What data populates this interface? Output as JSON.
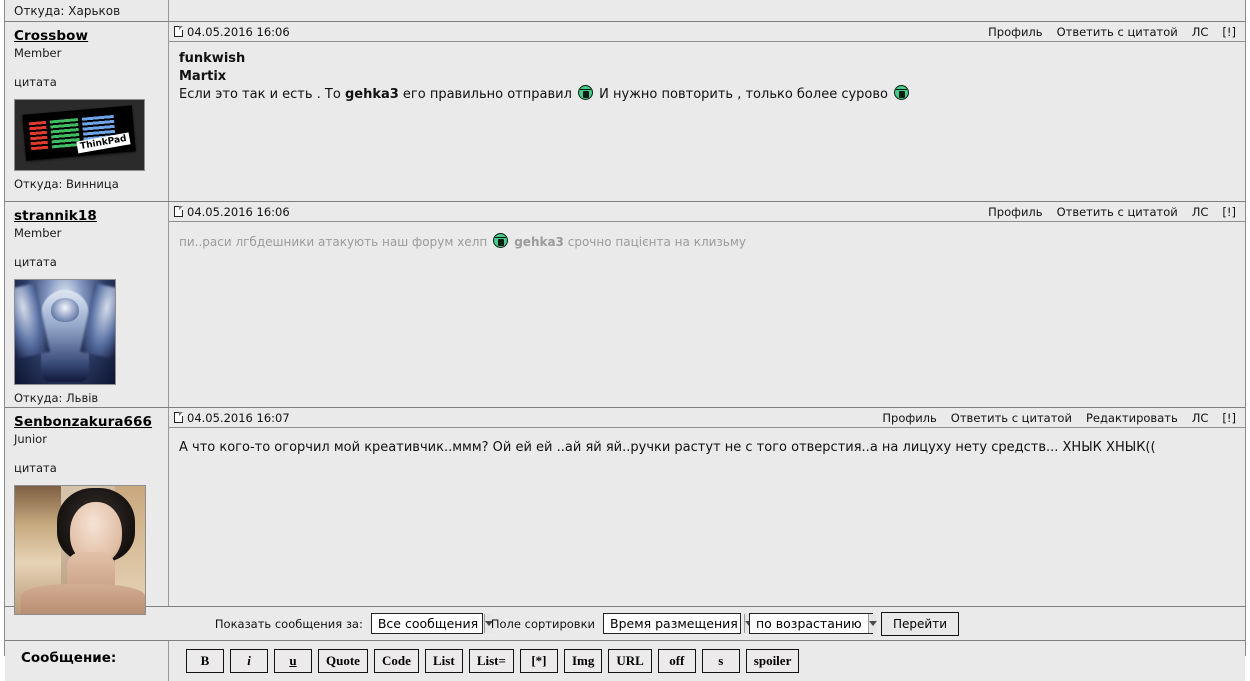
{
  "top_partial_row": {
    "location_label": "Откуда: Харьков"
  },
  "post_links": {
    "profile": "Профиль",
    "quote_reply": "Ответить с цитатой",
    "edit": "Редактировать",
    "pm": "ЛС",
    "report": "[!]"
  },
  "side_labels": {
    "quote": "цитата",
    "location_prefix": "Откуда:"
  },
  "posts": [
    {
      "username": "Crossbow",
      "rank": "Member",
      "quote_link": "цитата",
      "location": "Откуда: Винница",
      "avatar": "ibm-thinkpad-logo",
      "date": "04.05.2016 16:06",
      "links": [
        "Профиль",
        "Ответить с цитатой",
        "ЛС",
        "[!]"
      ],
      "quoted_names": [
        "funkwish",
        "Martix"
      ],
      "text_parts": [
        {
          "type": "text",
          "value": "Если это так и есть . То "
        },
        {
          "type": "bold",
          "value": "gehka3"
        },
        {
          "type": "text",
          "value": " его правильно отправил "
        },
        {
          "type": "smiley",
          "value": "green-smiley"
        },
        {
          "type": "text",
          "value": " И нужно повторить , только более сурово "
        },
        {
          "type": "smiley",
          "value": "green-smiley"
        }
      ]
    },
    {
      "username": "strannik18",
      "rank": "Member",
      "quote_link": "цитата",
      "location": "Откуда: Львів",
      "avatar": "warrior-angel-artwork",
      "date": "04.05.2016 16:06",
      "links": [
        "Профиль",
        "Ответить с цитатой",
        "ЛС",
        "[!]"
      ],
      "quoted_names": [],
      "text_parts": [
        {
          "type": "dim",
          "value": "пи..раси лгбдешники атакують наш форум хелп "
        },
        {
          "type": "smiley",
          "value": "green-smiley"
        },
        {
          "type": "dim-bold",
          "value": " gehka3"
        },
        {
          "type": "dim",
          "value": " срочно пацієнта на клизьму"
        }
      ]
    },
    {
      "username": "Senbonzakura666",
      "rank": "Junior",
      "quote_link": "цитата",
      "location": "",
      "avatar": "user-selfie-photo",
      "date": "04.05.2016 16:07",
      "links": [
        "Профиль",
        "Ответить с цитатой",
        "Редактировать",
        "ЛС",
        "[!]"
      ],
      "quoted_names": [],
      "text_parts": [
        {
          "type": "text",
          "value": "А что кого-то огорчил мой креативчик..ммм? Ой ей ей ..ай яй яй..ручки растут не с того отверстия..а на лицуху нету средств... ХНЫК ХНЫК(("
        }
      ]
    }
  ],
  "options_bar": {
    "show_messages_label": "Показать сообщения за:",
    "show_messages_value": "Все сообщения",
    "sort_field_label": "Поле сортировки",
    "sort_field_value": "Время размещения",
    "sort_order_value": "по возрастанию",
    "go_button": "Перейти"
  },
  "message_row": {
    "label": "Сообщение:",
    "bbcode_buttons": [
      "B",
      "i",
      "u",
      "Quote",
      "Code",
      "List",
      "List=",
      "[*]",
      "Img",
      "URL",
      "off",
      "s",
      "spoiler"
    ]
  },
  "colors": {
    "page_bg": "#eaeaea",
    "border": "#7f7f7f",
    "text": "#111111",
    "dim_text": "#9b9b9b",
    "smiley_green": "#49c98a"
  }
}
